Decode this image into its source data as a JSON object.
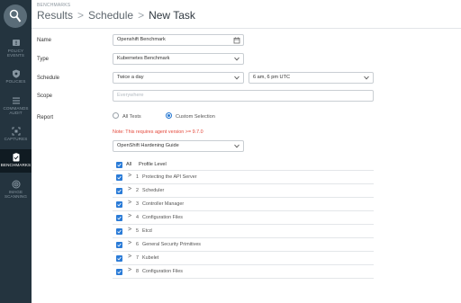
{
  "sidebar": {
    "items": [
      {
        "label": "POLICY\nEVENTS",
        "icon": "alert-icon"
      },
      {
        "label": "POLICIES",
        "icon": "shield-icon"
      },
      {
        "label": "COMMANDS\nAUDIT",
        "icon": "list-icon"
      },
      {
        "label": "CAPTURES",
        "icon": "capture-icon"
      },
      {
        "label": "BENCHMARKS",
        "icon": "clipboard-check-icon",
        "active": true
      },
      {
        "label": "IMAGE\nSCANNING",
        "icon": "scan-icon"
      }
    ]
  },
  "header": {
    "section": "BENCHMARKS",
    "crumbs": [
      "Results",
      "Schedule",
      "New Task"
    ],
    "separator": ">"
  },
  "form": {
    "name_label": "Name",
    "name_value": "Openshift Benchmark",
    "type_label": "Type",
    "type_value": "Kubernetes Benchmark",
    "schedule_label": "Schedule",
    "frequency_value": "Twice a day",
    "time_value": "6 am, 6 pm UTC",
    "scope_label": "Scope",
    "scope_placeholder": "Everywhere",
    "report_label": "Report",
    "report_options": [
      "All Tests",
      "Custom Selection"
    ],
    "report_selected": "Custom Selection",
    "note": "Note: This requires agent version >= 9.7.0",
    "guide_value": "OpenShift Hardening Guide"
  },
  "table": {
    "header_all": "All",
    "header_level": "Profile Level",
    "rows": [
      {
        "num": "1",
        "title": "Protecting the API Server"
      },
      {
        "num": "2",
        "title": "Scheduler"
      },
      {
        "num": "3",
        "title": "Controller Manager"
      },
      {
        "num": "4",
        "title": "Configuration Files"
      },
      {
        "num": "5",
        "title": "Etcd"
      },
      {
        "num": "6",
        "title": "General Security Primitives"
      },
      {
        "num": "7",
        "title": "Kubelet"
      },
      {
        "num": "8",
        "title": "Configuration Files"
      }
    ],
    "expand_glyph": ">"
  },
  "colors": {
    "sidebar_bg": "#24343f",
    "accent": "#2a7bd7",
    "warning": "#e4483b"
  }
}
